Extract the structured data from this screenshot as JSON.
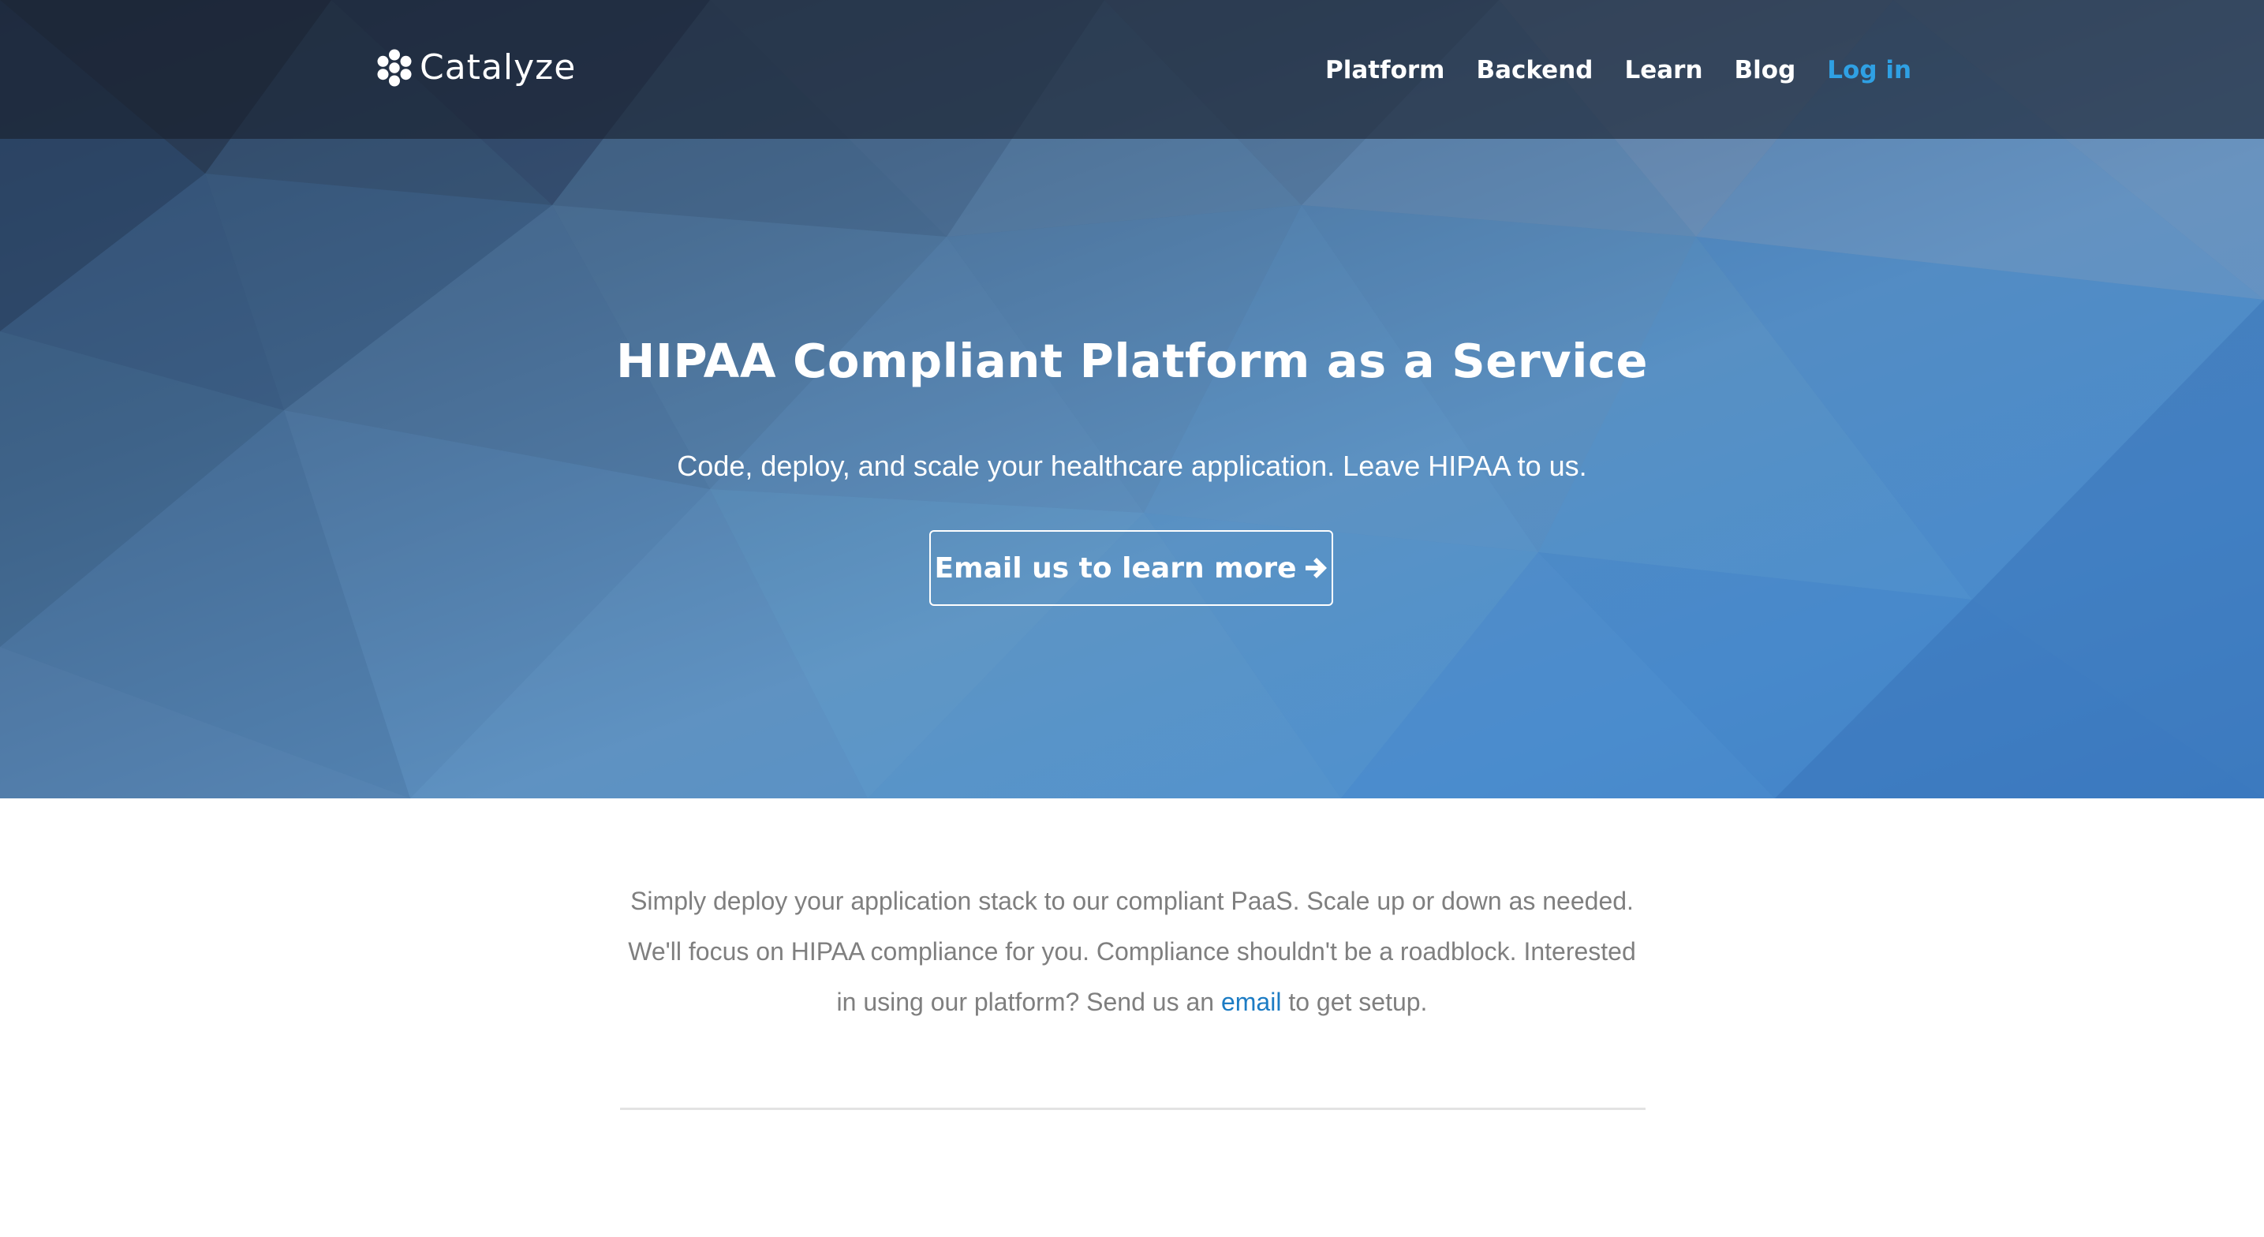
{
  "brand": {
    "name": "Catalyze",
    "logo_icon": "hexagon-cluster-icon"
  },
  "nav": {
    "items": [
      {
        "label": "Platform"
      },
      {
        "label": "Backend"
      },
      {
        "label": "Learn"
      },
      {
        "label": "Blog"
      }
    ],
    "login_label": "Log in"
  },
  "hero": {
    "title": "HIPAA Compliant Platform as a Service",
    "subtitle": "Code, deploy, and scale your healthcare application. Leave HIPAA to us.",
    "cta_label": "Email us to learn more",
    "cta_icon": "arrow-right-icon"
  },
  "intro": {
    "text_before": "Simply deploy your application stack to our compliant PaaS. Scale up or down as needed. We'll focus on HIPAA compliance for you. Compliance shouldn't be a roadblock. Interested in using our platform? Send us an ",
    "link_text": "email",
    "text_after": " to get setup."
  },
  "colors": {
    "nav_background": "#1c2333",
    "accent_link": "#2fa0e3",
    "body_link": "#1c7cc4",
    "body_text": "#7f7f7f",
    "hero_blue": "#4a8bcb"
  }
}
